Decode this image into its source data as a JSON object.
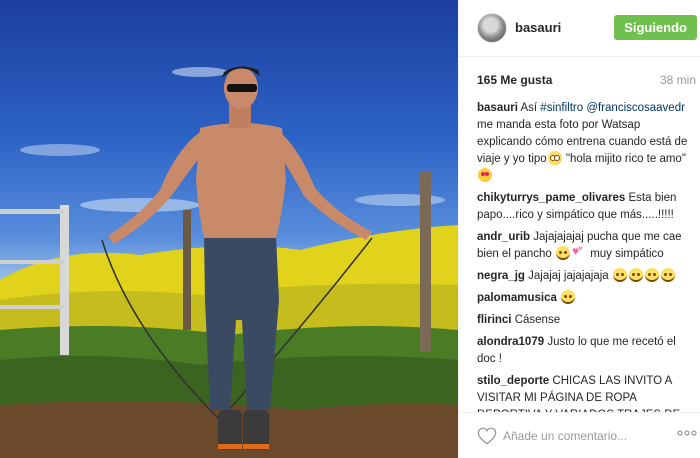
{
  "post": {
    "username": "basauri",
    "follow_label": "Siguiendo",
    "likes": "165 Me gusta",
    "time": "38 min",
    "colors": {
      "follow_button": "#70c050",
      "link": "#003569"
    }
  },
  "comments": [
    {
      "author": "basauri",
      "parts": [
        {
          "type": "text",
          "value": " Así "
        },
        {
          "type": "tag",
          "value": "#sinfiltro"
        },
        {
          "type": "text",
          "value": " "
        },
        {
          "type": "mention",
          "value": "@franciscosaavedr"
        },
        {
          "type": "text",
          "value": " me manda esta foto por Watsap explicando cómo entrena cuando está de viaje y yo tipo"
        },
        {
          "type": "emoji",
          "value": "flushed-face"
        },
        {
          "type": "text",
          "value": " \"hola mijito rico te amo\""
        },
        {
          "type": "emoji",
          "value": "heart-eyes-face"
        }
      ]
    },
    {
      "author": "chikyturrys_pame_olivares",
      "parts": [
        {
          "type": "text",
          "value": " Esta bien papo....rico y simpático que más.....!!!!!"
        }
      ]
    },
    {
      "author": "andr_urib",
      "parts": [
        {
          "type": "text",
          "value": " Jajajajajaj pucha que me cae bien el pancho "
        },
        {
          "type": "emoji",
          "value": "joy-face"
        },
        {
          "type": "emoji",
          "value": "two-hearts"
        },
        {
          "type": "text",
          "value": " muy simpático"
        }
      ]
    },
    {
      "author": "negra_jg",
      "parts": [
        {
          "type": "text",
          "value": " Jajajaj jajajajaja "
        },
        {
          "type": "emoji",
          "value": "joy-face"
        },
        {
          "type": "emoji",
          "value": "joy-face"
        },
        {
          "type": "emoji",
          "value": "joy-face"
        },
        {
          "type": "emoji",
          "value": "joy-face"
        }
      ]
    },
    {
      "author": "palomamusica",
      "parts": [
        {
          "type": "text",
          "value": " "
        },
        {
          "type": "emoji",
          "value": "joy-face"
        }
      ]
    },
    {
      "author": "flirinci",
      "parts": [
        {
          "type": "text",
          "value": " Cásense"
        }
      ]
    },
    {
      "author": "alondra1079",
      "parts": [
        {
          "type": "text",
          "value": " Justo lo que me recetó el doc !"
        }
      ]
    },
    {
      "author": "stilo_deporte",
      "parts": [
        {
          "type": "text",
          "value": " CHICAS LAS INVITO A VISITAR MI PÁGINA DE ROPA DEPORTIVA Y VARIADOS TRAJES DE BAÑOS DE EXCELENTE CALIDAD Y"
        }
      ]
    }
  ],
  "footer": {
    "comment_placeholder": "Añade un comentario...",
    "like_icon": "heart-outline-icon",
    "more_icon": "ellipsis-icon"
  }
}
